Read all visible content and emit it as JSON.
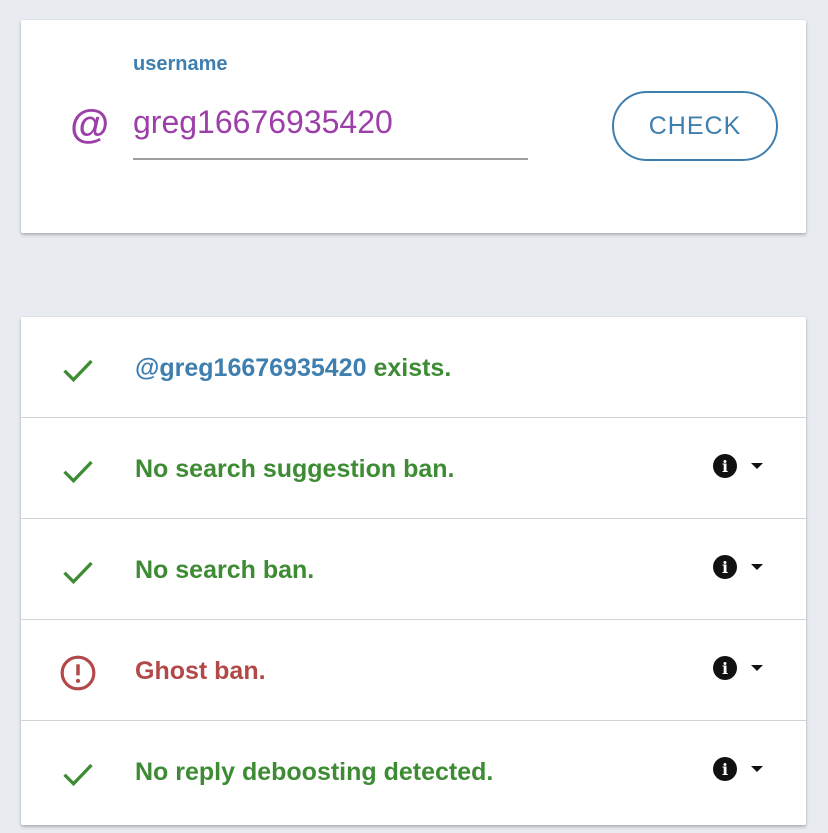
{
  "search": {
    "at_symbol": "@",
    "label": "username",
    "value": "greg16676935420",
    "button_label": "CHECK"
  },
  "colors": {
    "accent": "#3f7fb0",
    "username": "#9c3fa8",
    "success": "#3d8c34",
    "danger": "#b24848",
    "background": "#e8ecf1"
  },
  "results": {
    "exists": {
      "handle": "@greg16676935420",
      "suffix": " exists.",
      "status": "ok",
      "icon": "check-icon"
    },
    "suggestion": {
      "text": "No search suggestion ban.",
      "status": "ok",
      "icon": "check-icon"
    },
    "search": {
      "text": "No search ban.",
      "status": "ok",
      "icon": "check-icon"
    },
    "ghost": {
      "text": "Ghost ban.",
      "status": "bad",
      "icon": "alert-circle-icon"
    },
    "reply": {
      "text": "No reply deboosting detected.",
      "status": "ok",
      "icon": "check-icon"
    }
  },
  "info_icon": {
    "glyph": "i",
    "icon": "info-icon"
  }
}
